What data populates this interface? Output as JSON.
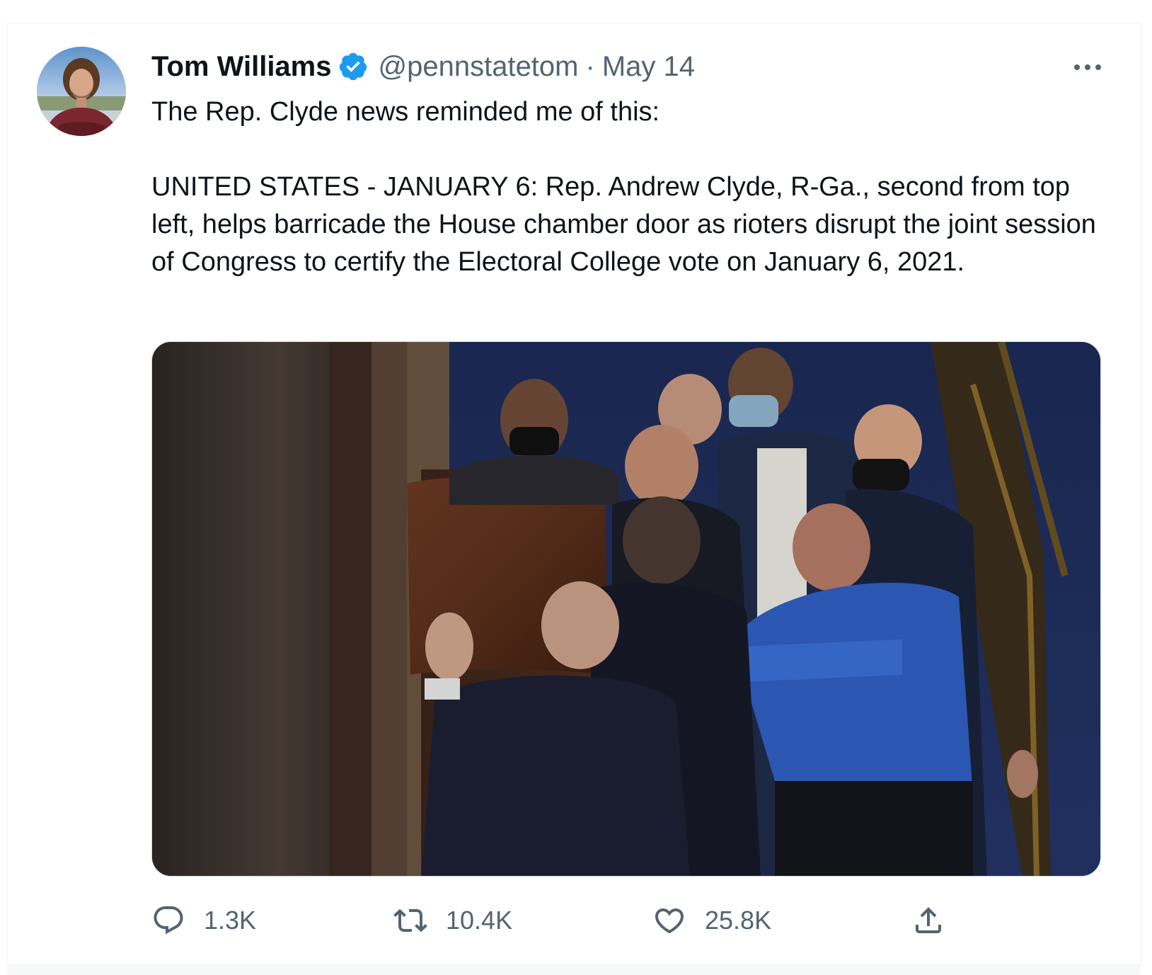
{
  "tweet": {
    "author": {
      "display_name": "Tom Williams",
      "handle": "@pennstatetom",
      "verified": true,
      "avatar_icon": "profile-photo"
    },
    "separator": "·",
    "date": "May 14",
    "text_lines": [
      "The Rep. Clyde news reminded me of this:",
      "UNITED STATES - JANUARY 6: Rep. Andrew Clyde, R-Ga., second from top left, helps barricade the House chamber door as rioters disrupt the joint session of Congress to certify the Electoral College vote on January 6, 2021."
    ],
    "media": {
      "type": "photo"
    },
    "actions": {
      "reply": {
        "icon": "reply-icon",
        "count": "1.3K"
      },
      "retweet": {
        "icon": "retweet-icon",
        "count": "10.4K"
      },
      "like": {
        "icon": "heart-icon",
        "count": "25.8K"
      },
      "share": {
        "icon": "share-icon"
      }
    }
  },
  "colors": {
    "accent": "#1d9bf0",
    "text_primary": "#0f1419",
    "text_secondary": "#536471",
    "border": "#eff3f4"
  }
}
